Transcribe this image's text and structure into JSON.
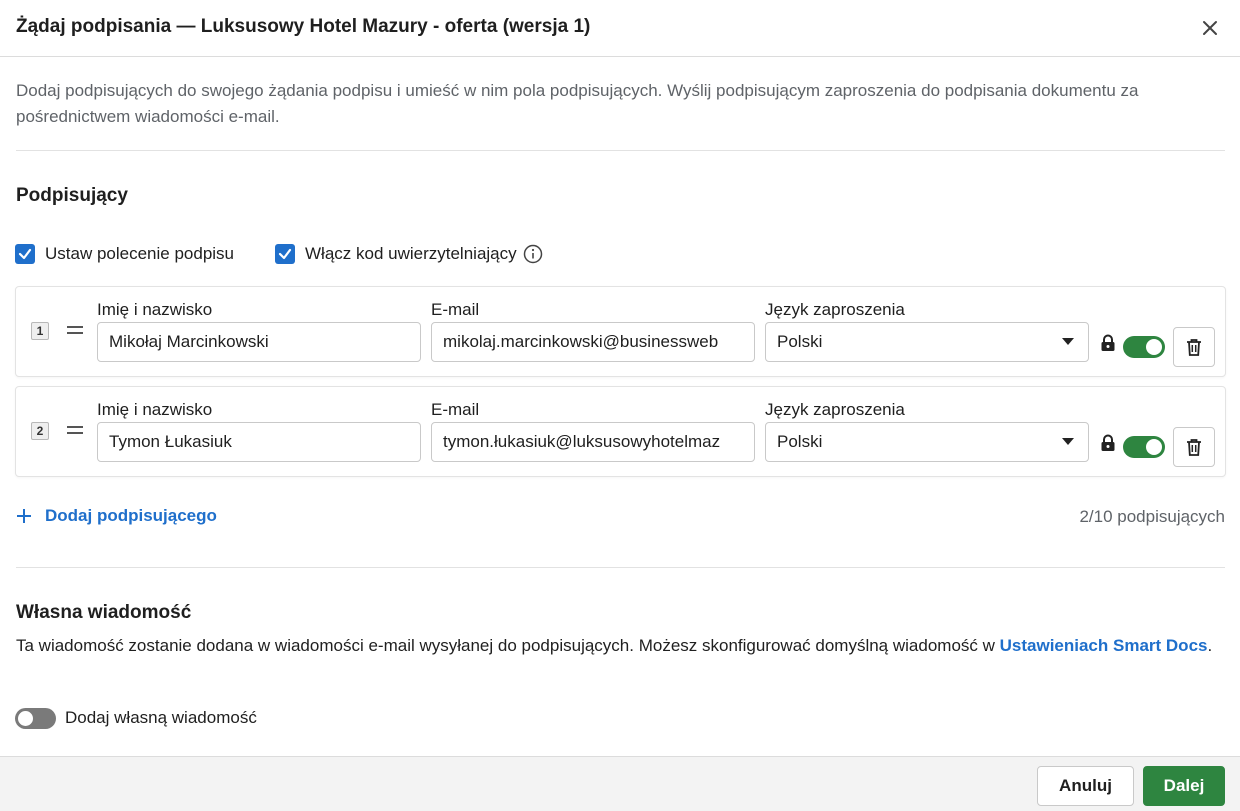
{
  "dialog": {
    "title": "Żądaj podpisania — Luksusowy Hotel Mazury - oferta (wersja 1)",
    "intro": "Dodaj podpisujących do swojego żądania podpisu i umieść w nim pola podpisujących. Wyślij podpisującym zaproszenia do podpisania dokumentu za pośrednictwem wiadomości e-mail."
  },
  "signers_section": {
    "title": "Podpisujący",
    "checkbox_order": {
      "label": "Ustaw polecenie podpisu",
      "checked": true
    },
    "checkbox_auth": {
      "label": "Włącz kod uwierzytelniający",
      "checked": true
    },
    "labels": {
      "name": "Imię i nazwisko",
      "email": "E-mail",
      "language": "Język zaproszenia"
    },
    "signers": [
      {
        "number": "1",
        "name": "Mikołaj Marcinkowski",
        "email": "mikolaj.marcinkowski@businessweb",
        "language": "Polski",
        "auth_enabled": true
      },
      {
        "number": "2",
        "name": "Tymon Łukasiuk",
        "email": "tymon.łukasiuk@luksusowyhotelmaz",
        "language": "Polski",
        "auth_enabled": true
      }
    ],
    "add_signer": "Dodaj podpisującego",
    "count": "2/10 podpisujących"
  },
  "message_section": {
    "title": "Własna wiadomość",
    "description": "Ta wiadomość zostanie dodana w wiadomości e-mail wysyłanej do podpisujących. Możesz skonfigurować domyślną wiadomość w ",
    "link": "Ustawieniach Smart Docs",
    "description_end": ".",
    "toggle_label": "Dodaj własną wiadomość",
    "toggle_on": false
  },
  "footer": {
    "cancel": "Anuluj",
    "next": "Dalej"
  },
  "colors": {
    "accent_blue": "#1f6fcb",
    "primary_green": "#2e8540",
    "muted_text": "#5f6368"
  },
  "icons": [
    "close-icon",
    "checkbox-checked-icon",
    "info-icon",
    "drag-handle-icon",
    "chevron-down-icon",
    "lock-icon",
    "trash-icon",
    "plus-icon"
  ]
}
